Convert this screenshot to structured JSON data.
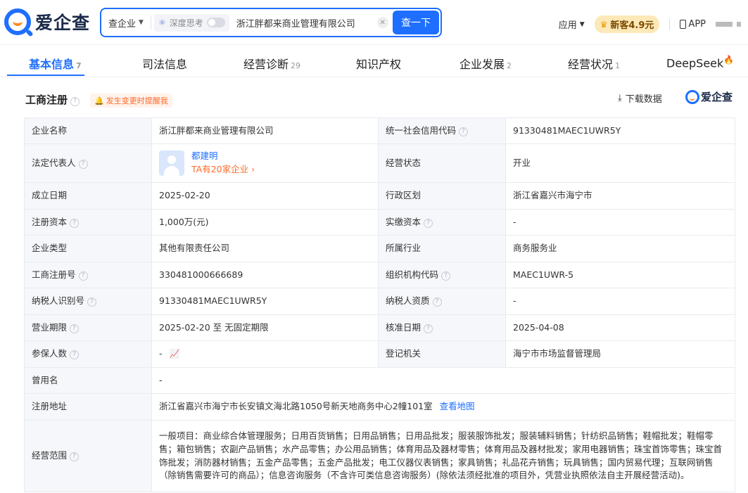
{
  "header": {
    "logo_text": "爱企查",
    "search": {
      "type_label": "查企业",
      "deep_label": "深度思考",
      "query": "浙江胖都来商业管理有限公司",
      "button_label": "查一下"
    },
    "apps_label": "应用",
    "vip_label": "新客4.9元",
    "app_label": "APP"
  },
  "tabs": [
    {
      "label": "基本信息",
      "count": "7"
    },
    {
      "label": "司法信息",
      "count": ""
    },
    {
      "label": "经营诊断",
      "count": "29"
    },
    {
      "label": "知识产权",
      "count": ""
    },
    {
      "label": "企业发展",
      "count": "2"
    },
    {
      "label": "经营状况",
      "count": "1"
    },
    {
      "label": "DeepSeek",
      "count": ""
    }
  ],
  "section": {
    "title": "工商注册",
    "remind_label": "发生变更时提醒我",
    "download_label": "下载数据",
    "brand_label": "爱企查"
  },
  "info": {
    "company_name_label": "企业名称",
    "company_name": "浙江胖都来商业管理有限公司",
    "credit_code_label": "统一社会信用代码",
    "credit_code": "91330481MAEC1UWR5Y",
    "legal_rep_label": "法定代表人",
    "legal_rep_name": "都建明",
    "legal_rep_link": "TA有20家企业",
    "status_label": "经营状态",
    "status": "开业",
    "found_date_label": "成立日期",
    "found_date": "2025-02-20",
    "region_label": "行政区划",
    "region": "浙江省嘉兴市海宁市",
    "reg_capital_label": "注册资本",
    "reg_capital": "1,000万(元)",
    "paid_capital_label": "实缴资本",
    "paid_capital": "-",
    "type_label": "企业类型",
    "type": "其他有限责任公司",
    "industry_label": "所属行业",
    "industry": "商务服务业",
    "reg_no_label": "工商注册号",
    "reg_no": "330481000666689",
    "org_code_label": "组织机构代码",
    "org_code": "MAEC1UWR-5",
    "taxpayer_id_label": "纳税人识别号",
    "taxpayer_id": "91330481MAEC1UWR5Y",
    "taxpayer_qual_label": "纳税人资质",
    "taxpayer_qual": "-",
    "term_label": "营业期限",
    "term": "2025-02-20 至 无固定期限",
    "approve_date_label": "核准日期",
    "approve_date": "2025-04-08",
    "insured_label": "参保人数",
    "insured": "-",
    "authority_label": "登记机关",
    "authority": "海宁市市场监督管理局",
    "former_name_label": "曾用名",
    "former_name": "-",
    "address_label": "注册地址",
    "address": "浙江省嘉兴市海宁市长安镇文海北路1050号新天地商务中心2幢101室",
    "map_link": "查看地图",
    "scope_label": "经营范围",
    "scope": "一般项目：商业综合体管理服务；日用百货销售；日用品销售；日用品批发；服装服饰批发；服装辅料销售；针纺织品销售；鞋帽批发；鞋帽零售；箱包销售；农副产品销售；水产品零售；办公用品销售；体育用品及器材零售；体育用品及器材批发；家用电器销售；珠宝首饰零售；珠宝首饰批发；消防器材销售；五金产品零售；五金产品批发；电工仪器仪表销售；家具销售；礼品花卉销售；玩具销售；国内贸易代理；互联网销售（除销售需要许可的商品）；信息咨询服务（不含许可类信息咨询服务）(除依法须经批准的项目外，凭营业执照依法自主开展经营活动)。"
  }
}
